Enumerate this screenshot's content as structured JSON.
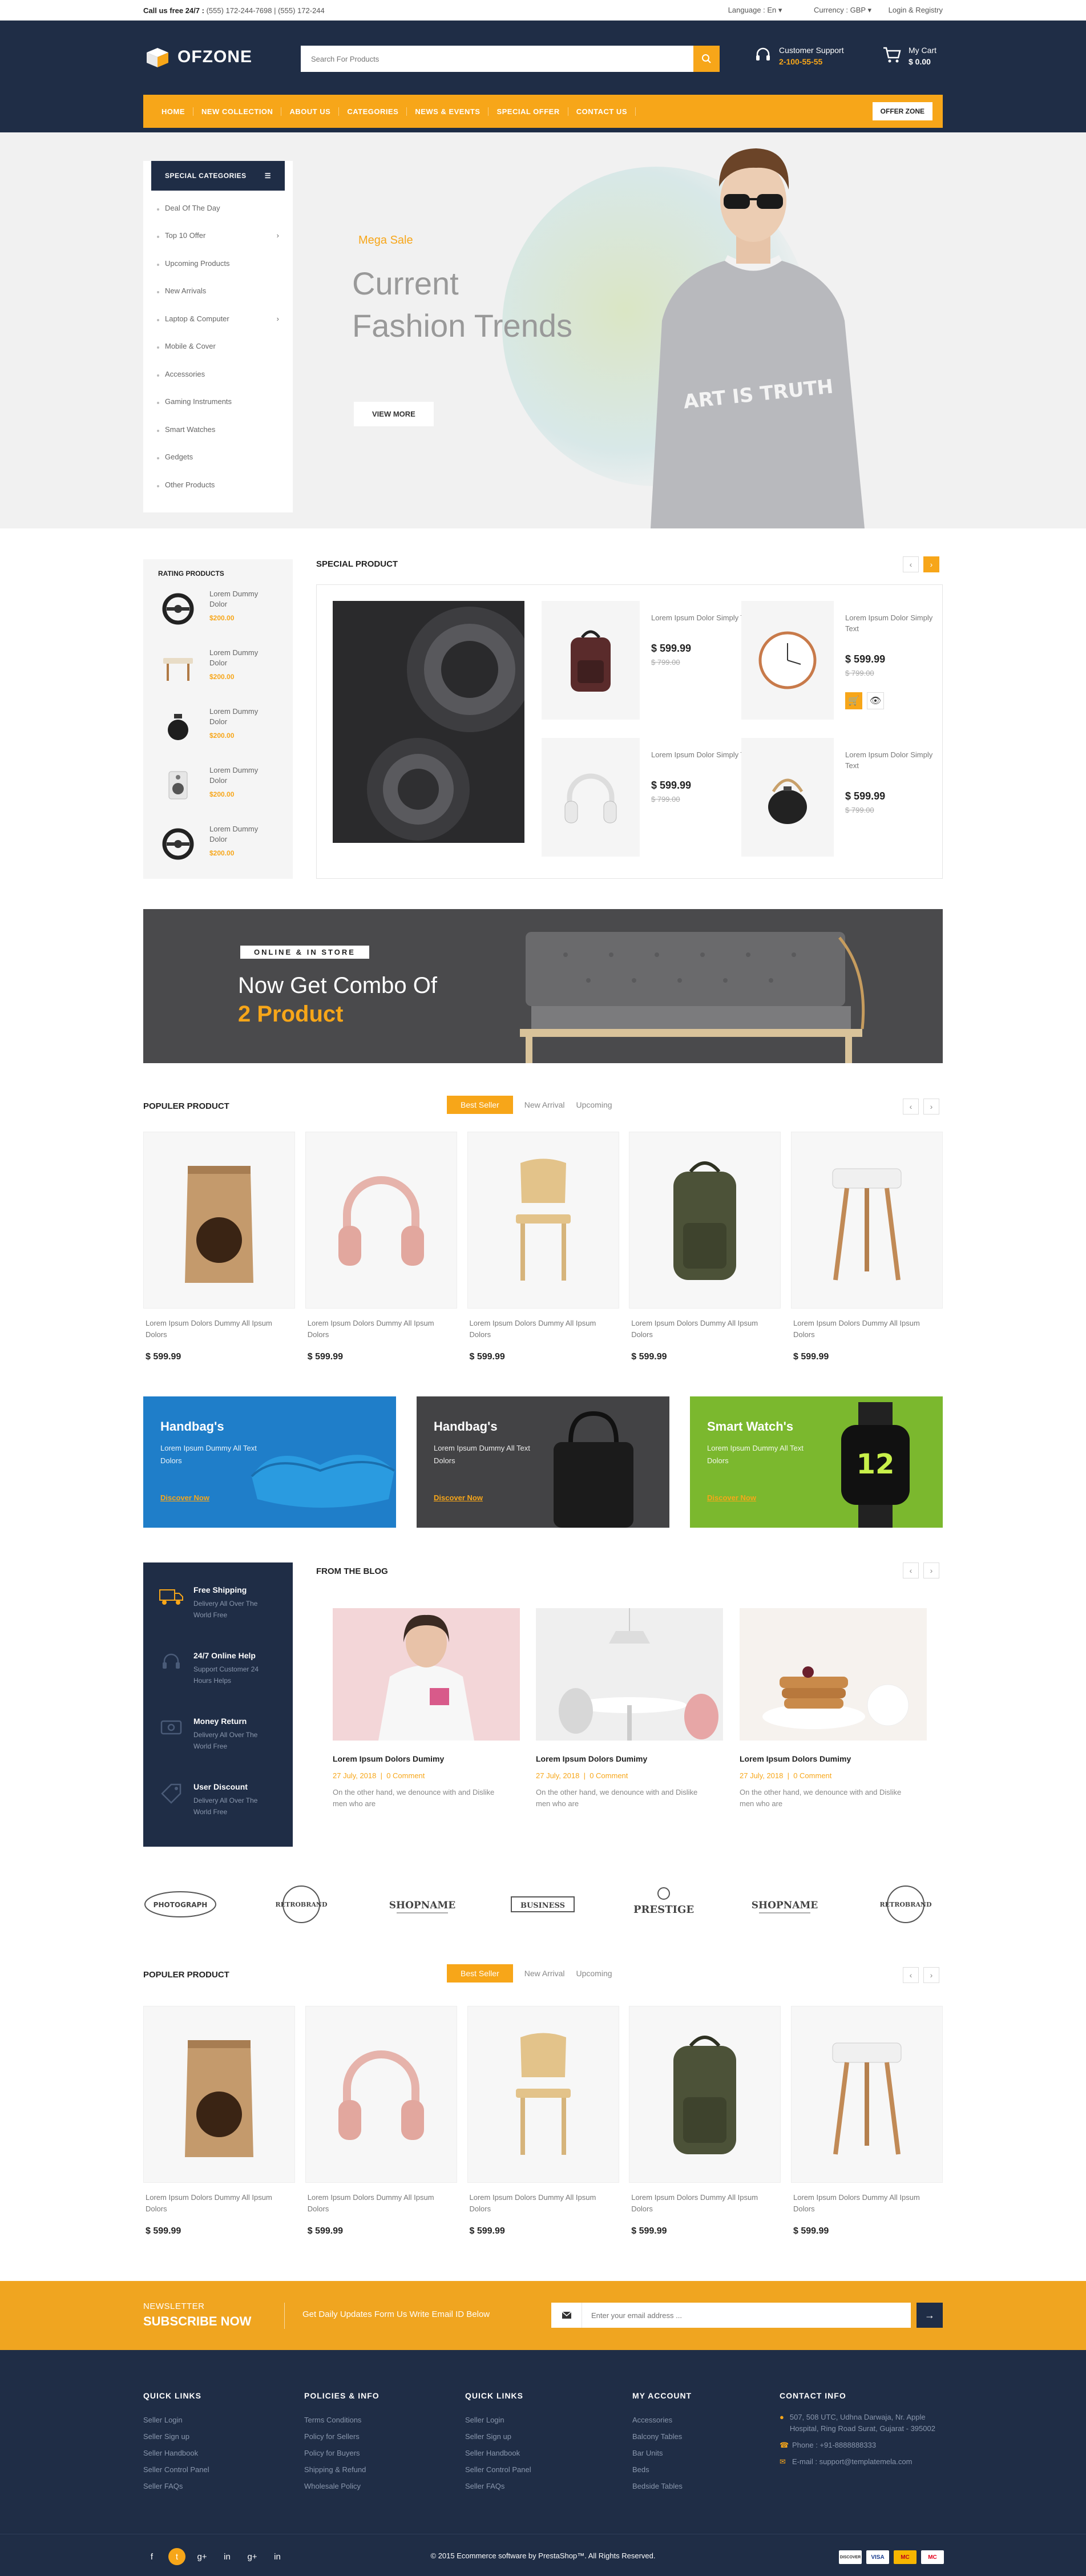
{
  "topbar": {
    "call_label": "Call us free 24/7 :",
    "call_numbers": "(555) 172-244-7698 | (555) 172-244",
    "language": "Language : En",
    "currency": "Currency : GBP",
    "account": "Login & Registry"
  },
  "header": {
    "logo_text": "OFZONE",
    "search_placeholder": "Search For Products",
    "support_label": "Customer Support",
    "support_number": "2-100-55-55",
    "cart_label": "My Cart",
    "cart_amount": "$ 0.00"
  },
  "nav": {
    "items": [
      "HOME",
      "NEW COLLECTION",
      "ABOUT US",
      "CATEGORIES",
      "NEWS & EVENTS",
      "SPECIAL OFFER",
      "CONTACT US"
    ],
    "offer": "OFFER ZONE"
  },
  "categories": {
    "title": "SPECIAL CATEGORIES",
    "items": [
      {
        "label": "Deal Of The Day",
        "arrow": false
      },
      {
        "label": "Top 10 Offer",
        "arrow": true
      },
      {
        "label": "Upcoming Products",
        "arrow": false
      },
      {
        "label": "New Arrivals",
        "arrow": false
      },
      {
        "label": "Laptop & Computer",
        "arrow": true
      },
      {
        "label": "Mobile & Cover",
        "arrow": false
      },
      {
        "label": "Accessories",
        "arrow": false
      },
      {
        "label": "Gaming Instruments",
        "arrow": false
      },
      {
        "label": "Smart Watches",
        "arrow": false
      },
      {
        "label": "Gedgets",
        "arrow": false
      },
      {
        "label": "Other Products",
        "arrow": false
      }
    ]
  },
  "hero": {
    "tag": "Mega Sale",
    "title_line1": "Current",
    "title_line2": "Fashion Trends",
    "button": "VIEW MORE",
    "shirt_text": "ART IS TRUTH"
  },
  "rating": {
    "title": "RATING PRODUCTS",
    "items": [
      {
        "name": "Lorem Dummy Dolor",
        "price": "$200.00",
        "icon": "steering-wheel-icon"
      },
      {
        "name": "Lorem Dummy Dolor",
        "price": "$200.00",
        "icon": "stool-icon"
      },
      {
        "name": "Lorem Dummy Dolor",
        "price": "$200.00",
        "icon": "kettle-icon"
      },
      {
        "name": "Lorem Dummy Dolor",
        "price": "$200.00",
        "icon": "speaker-icon"
      },
      {
        "name": "Lorem Dummy Dolor",
        "price": "$200.00",
        "icon": "steering-wheel-icon"
      }
    ]
  },
  "special": {
    "title": "SPECIAL PRODUCT",
    "items": [
      {
        "name": "Lorem Ipsum Dolor Simply Text",
        "price": "$ 599.99",
        "old": "$ 799.00",
        "icon": "backpack-icon"
      },
      {
        "name": "Lorem Ipsum Dolor Simply Text",
        "price": "$ 599.99",
        "old": "$ 799.00",
        "icon": "clock-icon"
      },
      {
        "name": "Lorem Ipsum Dolor Simply Text",
        "price": "$ 599.99",
        "old": "$ 799.00",
        "icon": "headphones-icon"
      },
      {
        "name": "Lorem Ipsum Dolor Simply Text",
        "price": "$ 599.99",
        "old": "$ 799.00",
        "icon": "teapot-icon"
      }
    ]
  },
  "combo": {
    "label": "ONLINE & IN STORE",
    "line1": "Now Get Combo Of",
    "line2": "2 Product"
  },
  "popular1": {
    "title": "POPULER PRODUCT",
    "tabs": [
      "Best Seller",
      "New Arrival",
      "Upcoming"
    ],
    "items": [
      {
        "name": "Lorem Ipsum Dolors Dummy All Ipsum Dolors",
        "price": "$ 599.99",
        "icon": "coffee-bag-icon"
      },
      {
        "name": "Lorem Ipsum Dolors Dummy All Ipsum Dolors",
        "price": "$ 599.99",
        "icon": "headphones-icon"
      },
      {
        "name": "Lorem Ipsum Dolors Dummy All Ipsum Dolors",
        "price": "$ 599.99",
        "icon": "chair-icon"
      },
      {
        "name": "Lorem Ipsum Dolors Dummy All Ipsum Dolors",
        "price": "$ 599.99",
        "icon": "backpack-icon"
      },
      {
        "name": "Lorem Ipsum Dolors Dummy All Ipsum Dolors",
        "price": "$ 599.99",
        "icon": "stool-icon"
      }
    ]
  },
  "promos": [
    {
      "title": "Handbag's",
      "desc": "Lorem Ipsum Dummy All Text Dolors",
      "link": "Discover Now",
      "color": "#1f7ec9"
    },
    {
      "title": "Handbag's",
      "desc": "Lorem Ipsum Dummy All Text Dolors",
      "link": "Discover Now",
      "color": "#434345"
    },
    {
      "title": "Smart Watch's",
      "desc": "Lorem Ipsum Dummy All Text Dolors",
      "link": "Discover Now",
      "color": "#7bb82e"
    }
  ],
  "promo_watch_digits": "12",
  "services": [
    {
      "title": "Free Shipping",
      "desc": "Delivery All Over The World Free",
      "icon": "truck-icon"
    },
    {
      "title": "24/7 Online Help",
      "desc": "Support Customer 24 Hours Helps",
      "icon": "support-icon"
    },
    {
      "title": "Money Return",
      "desc": "Delivery All Over The World Free",
      "icon": "money-icon"
    },
    {
      "title": "User Discount",
      "desc": "Delivery All Over The World Free",
      "icon": "discount-icon"
    }
  ],
  "blog": {
    "title": "FROM THE BLOG",
    "items": [
      {
        "title": "Lorem Ipsum Dolors Dumimy",
        "date": "27 July, 2018",
        "comments": "0 Comment",
        "desc": "On the other hand, we denounce with and Dislike men who are"
      },
      {
        "title": "Lorem Ipsum Dolors Dumimy",
        "date": "27 July, 2018",
        "comments": "0 Comment",
        "desc": "On the other hand, we denounce with and Dislike men who are"
      },
      {
        "title": "Lorem Ipsum Dolors Dumimy",
        "date": "27 July, 2018",
        "comments": "0 Comment",
        "desc": "On the other hand, we denounce with and Dislike men who are"
      }
    ]
  },
  "brands": [
    "PHOTOGRAPH",
    "RETROBRAND",
    "SHOPNAME",
    "BUSINESS",
    "PRESTIGE",
    "SHOPNAME",
    "RETROBRAND"
  ],
  "popular2": {
    "title": "POPULER PRODUCT",
    "tabs": [
      "Best Seller",
      "New Arrival",
      "Upcoming"
    ],
    "items": [
      {
        "name": "Lorem Ipsum Dolors Dummy All Ipsum Dolors",
        "price": "$ 599.99",
        "icon": "coffee-bag-icon"
      },
      {
        "name": "Lorem Ipsum Dolors Dummy All Ipsum Dolors",
        "price": "$ 599.99",
        "icon": "headphones-icon"
      },
      {
        "name": "Lorem Ipsum Dolors Dummy All Ipsum Dolors",
        "price": "$ 599.99",
        "icon": "chair-icon"
      },
      {
        "name": "Lorem Ipsum Dolors Dummy All Ipsum Dolors",
        "price": "$ 599.99",
        "icon": "backpack-icon"
      },
      {
        "name": "Lorem Ipsum Dolors Dummy All Ipsum Dolors",
        "price": "$ 599.99",
        "icon": "stool-icon"
      }
    ]
  },
  "newsletter": {
    "kicker": "NEWSLETTER",
    "title": "SUBSCRIBE NOW",
    "message": "Get Daily Updates Form Us Write Email ID Below",
    "placeholder": "Enter your email address ..."
  },
  "footer": {
    "cols": [
      {
        "title": "QUICK LINKS",
        "links": [
          "Seller Login",
          "Seller Sign up",
          "Seller Handbook",
          "Seller Control Panel",
          "Seller FAQs"
        ]
      },
      {
        "title": "POLICIES & INFO",
        "links": [
          "Terms Conditions",
          "Policy for Sellers",
          "Policy for Buyers",
          "Shipping & Refund",
          "Wholesale Policy"
        ]
      },
      {
        "title": "QUICK LINKS",
        "links": [
          "Seller Login",
          "Seller Sign up",
          "Seller Handbook",
          "Seller Control Panel",
          "Seller FAQs"
        ]
      },
      {
        "title": "MY ACCOUNT",
        "links": [
          "Accessories",
          "Balcony Tables",
          "Bar Units",
          "Beds",
          "Bedside Tables"
        ]
      }
    ],
    "contact_title": "CONTACT INFO",
    "contact": {
      "address": "507, 508 UTC, Udhna Darwaja, Nr. Apple Hospital, Ring Road Surat, Gujarat - 395002",
      "phone": "Phone : +91-8888888333",
      "email": "E-mail : support@templatemela.com"
    },
    "copyright": "© 2015 Ecommerce software by PrestaShop™. All Rights Reserved.",
    "payments": [
      "DISCOVER",
      "VISA",
      "MC",
      "MC"
    ]
  },
  "colors": {
    "navy": "#1f2d46",
    "accent": "#f7a619"
  }
}
